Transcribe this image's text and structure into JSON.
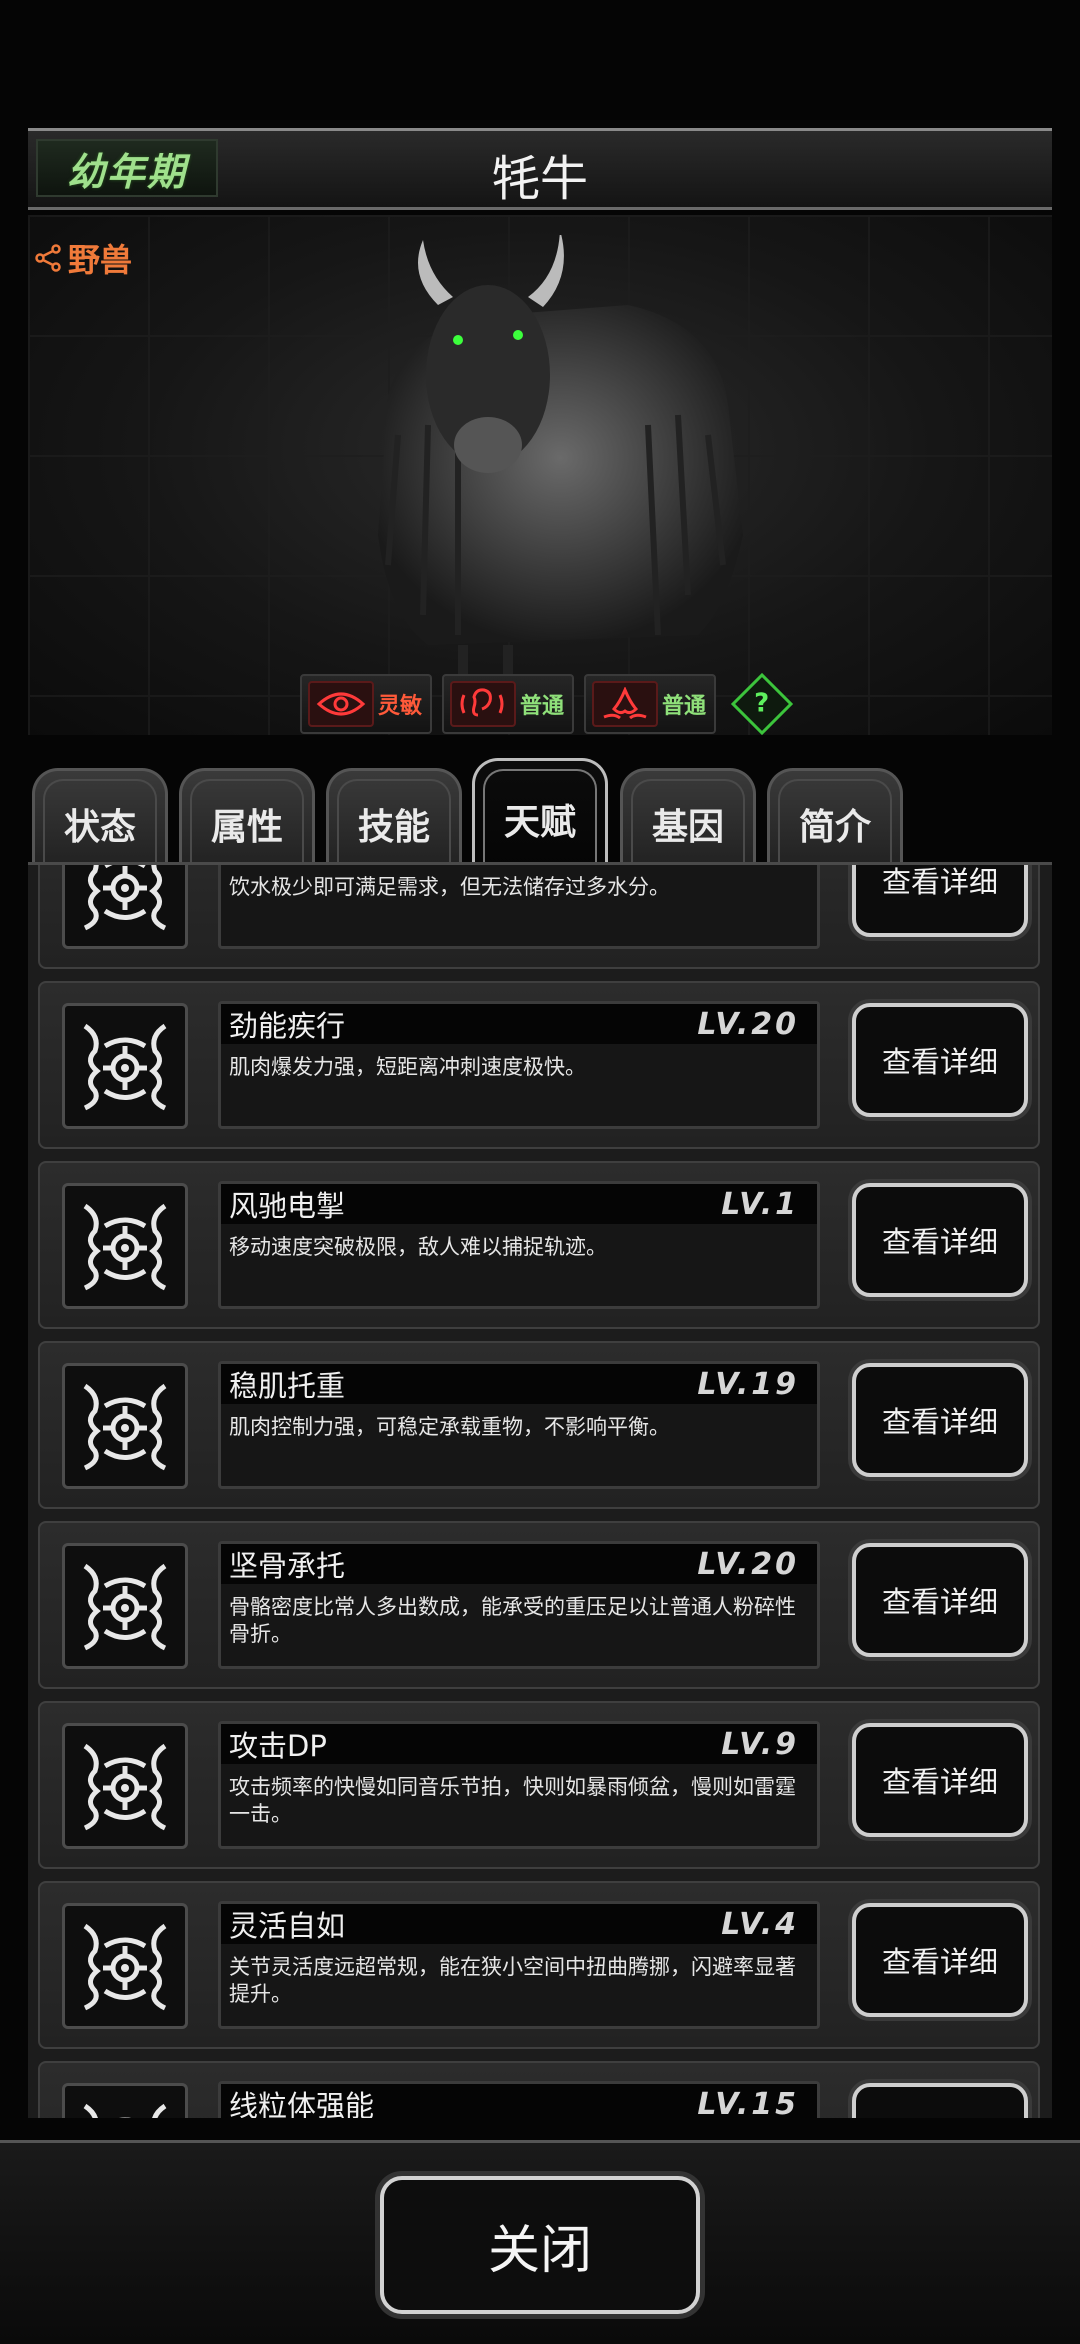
{
  "header": {
    "stage": "幼年期",
    "title": "牦牛"
  },
  "creature": {
    "type_label": "野兽"
  },
  "senses": [
    {
      "icon": "eye-icon",
      "label": "灵敏",
      "color": "#ff5a3a"
    },
    {
      "icon": "ear-icon",
      "label": "普通",
      "color": "#8fe07a"
    },
    {
      "icon": "nose-icon",
      "label": "普通",
      "color": "#8fe07a"
    }
  ],
  "help_symbol": "?",
  "tabs": [
    {
      "label": "状态",
      "active": false
    },
    {
      "label": "属性",
      "active": false
    },
    {
      "label": "技能",
      "active": false
    },
    {
      "label": "天赋",
      "active": true
    },
    {
      "label": "基因",
      "active": false
    },
    {
      "label": "简介",
      "active": false
    }
  ],
  "detail_label": "查看详细",
  "talents": [
    {
      "name": "",
      "level": "",
      "desc": "饮水极少即可满足需求，但无法储存过多水分。"
    },
    {
      "name": "劲能疾行",
      "level": "LV.20",
      "desc": "肌肉爆发力强，短距离冲刺速度极快。"
    },
    {
      "name": "风驰电掣",
      "level": "LV.1",
      "desc": "移动速度突破极限，敌人难以捕捉轨迹。"
    },
    {
      "name": "稳肌托重",
      "level": "LV.19",
      "desc": "肌肉控制力强，可稳定承载重物，不影响平衡。"
    },
    {
      "name": "坚骨承托",
      "level": "LV.20",
      "desc": "骨骼密度比常人多出数成，能承受的重压足以让普通人粉碎性骨折。"
    },
    {
      "name": "攻击DP",
      "level": "LV.9",
      "desc": "攻击频率的快慢如同音乐节拍，快则如暴雨倾盆，慢则如雷霆一击。"
    },
    {
      "name": "灵活自如",
      "level": "LV.4",
      "desc": "关节灵活度远超常规，能在狭小空间中扭曲腾挪，闪避率显著提升。"
    },
    {
      "name": "线粒体强能",
      "level": "LV.15",
      "desc": ""
    }
  ],
  "close_label": "关闭"
}
